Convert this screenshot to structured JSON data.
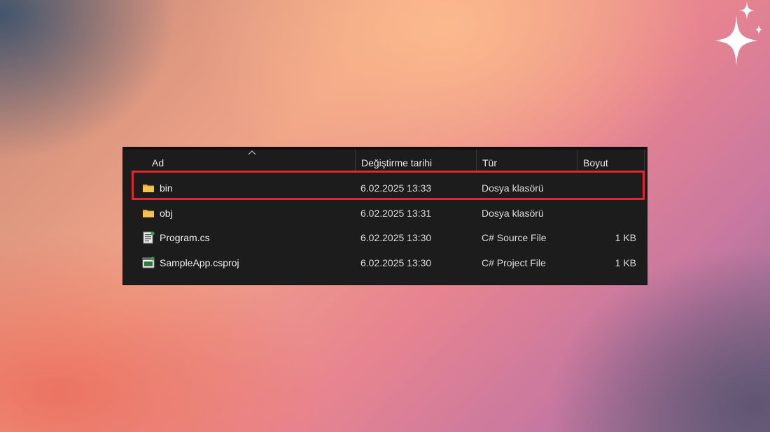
{
  "columns": {
    "name": "Ad",
    "date": "Değiştirme tarihi",
    "type": "Tür",
    "size": "Boyut"
  },
  "files": [
    {
      "name": "bin",
      "date": "6.02.2025 13:33",
      "type": "Dosya klasörü",
      "size": "",
      "icon": "folder-icon",
      "highlighted": true
    },
    {
      "name": "obj",
      "date": "6.02.2025 13:31",
      "type": "Dosya klasörü",
      "size": "",
      "icon": "folder-icon",
      "highlighted": false
    },
    {
      "name": "Program.cs",
      "date": "6.02.2025 13:30",
      "type": "C# Source File",
      "size": "1 KB",
      "icon": "csharp-source-file-icon",
      "highlighted": false
    },
    {
      "name": "SampleApp.csproj",
      "date": "6.02.2025 13:30",
      "type": "C# Project File",
      "size": "1 KB",
      "icon": "csharp-project-file-icon",
      "highlighted": false
    }
  ],
  "colors": {
    "highlight_border": "#e3262e",
    "panel_background": "#1c1c1c",
    "folder": "#f4c24e"
  },
  "decoration": {
    "sparkle_icon": "sparkle-icon"
  }
}
